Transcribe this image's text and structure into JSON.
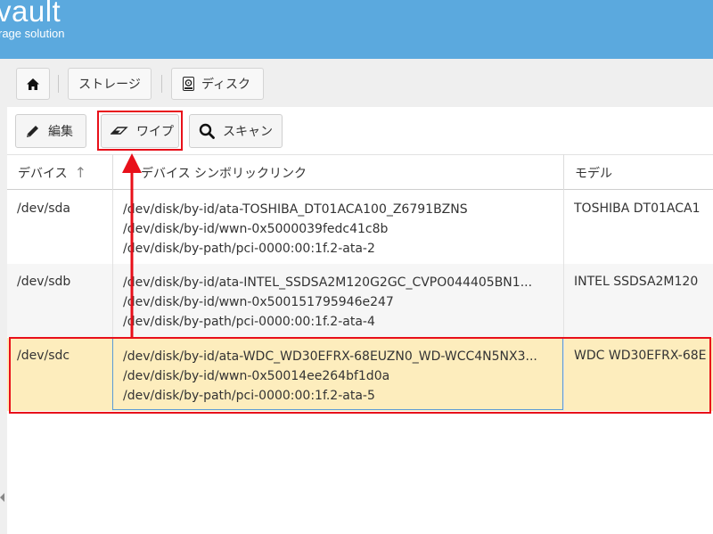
{
  "header": {
    "brand": "vault",
    "brand_sub": "rage solution"
  },
  "breadcrumb": {
    "home_icon": "home-icon",
    "storage_label": "ストレージ",
    "disk_icon": "disk-icon",
    "disk_label": "ディスク"
  },
  "toolbar": {
    "edit_label": "編集",
    "edit_icon": "pencil-icon",
    "wipe_label": "ワイプ",
    "wipe_icon": "eraser-icon",
    "scan_label": "スキャン",
    "scan_icon": "search-icon"
  },
  "table": {
    "columns": [
      "デバイス",
      "デバイス シンボリックリンク",
      "モデル"
    ],
    "sort_indicator": "↑",
    "rows": [
      {
        "device": "/dev/sda",
        "links": [
          "/dev/disk/by-id/ata-TOSHIBA_DT01ACA100_Z6791BZNS",
          "/dev/disk/by-id/wwn-0x5000039fedc41c8b",
          "/dev/disk/by-path/pci-0000:00:1f.2-ata-2"
        ],
        "model": "TOSHIBA DT01ACA1"
      },
      {
        "device": "/dev/sdb",
        "links": [
          "/dev/disk/by-id/ata-INTEL_SSDSA2M120G2GC_CVPO044405BN1...",
          "/dev/disk/by-id/wwn-0x500151795946e247",
          "/dev/disk/by-path/pci-0000:00:1f.2-ata-4"
        ],
        "model": "INTEL SSDSA2M120"
      },
      {
        "device": "/dev/sdc",
        "links": [
          "/dev/disk/by-id/ata-WDC_WD30EFRX-68EUZN0_WD-WCC4N5NX3...",
          "/dev/disk/by-id/wwn-0x50014ee264bf1d0a",
          "/dev/disk/by-path/pci-0000:00:1f.2-ata-5"
        ],
        "model": "WDC WD30EFRX-68E"
      }
    ]
  },
  "colors": {
    "header_bg": "#5ba9de",
    "selected_row": "#fdedbd",
    "annotation": "#e8101a"
  }
}
